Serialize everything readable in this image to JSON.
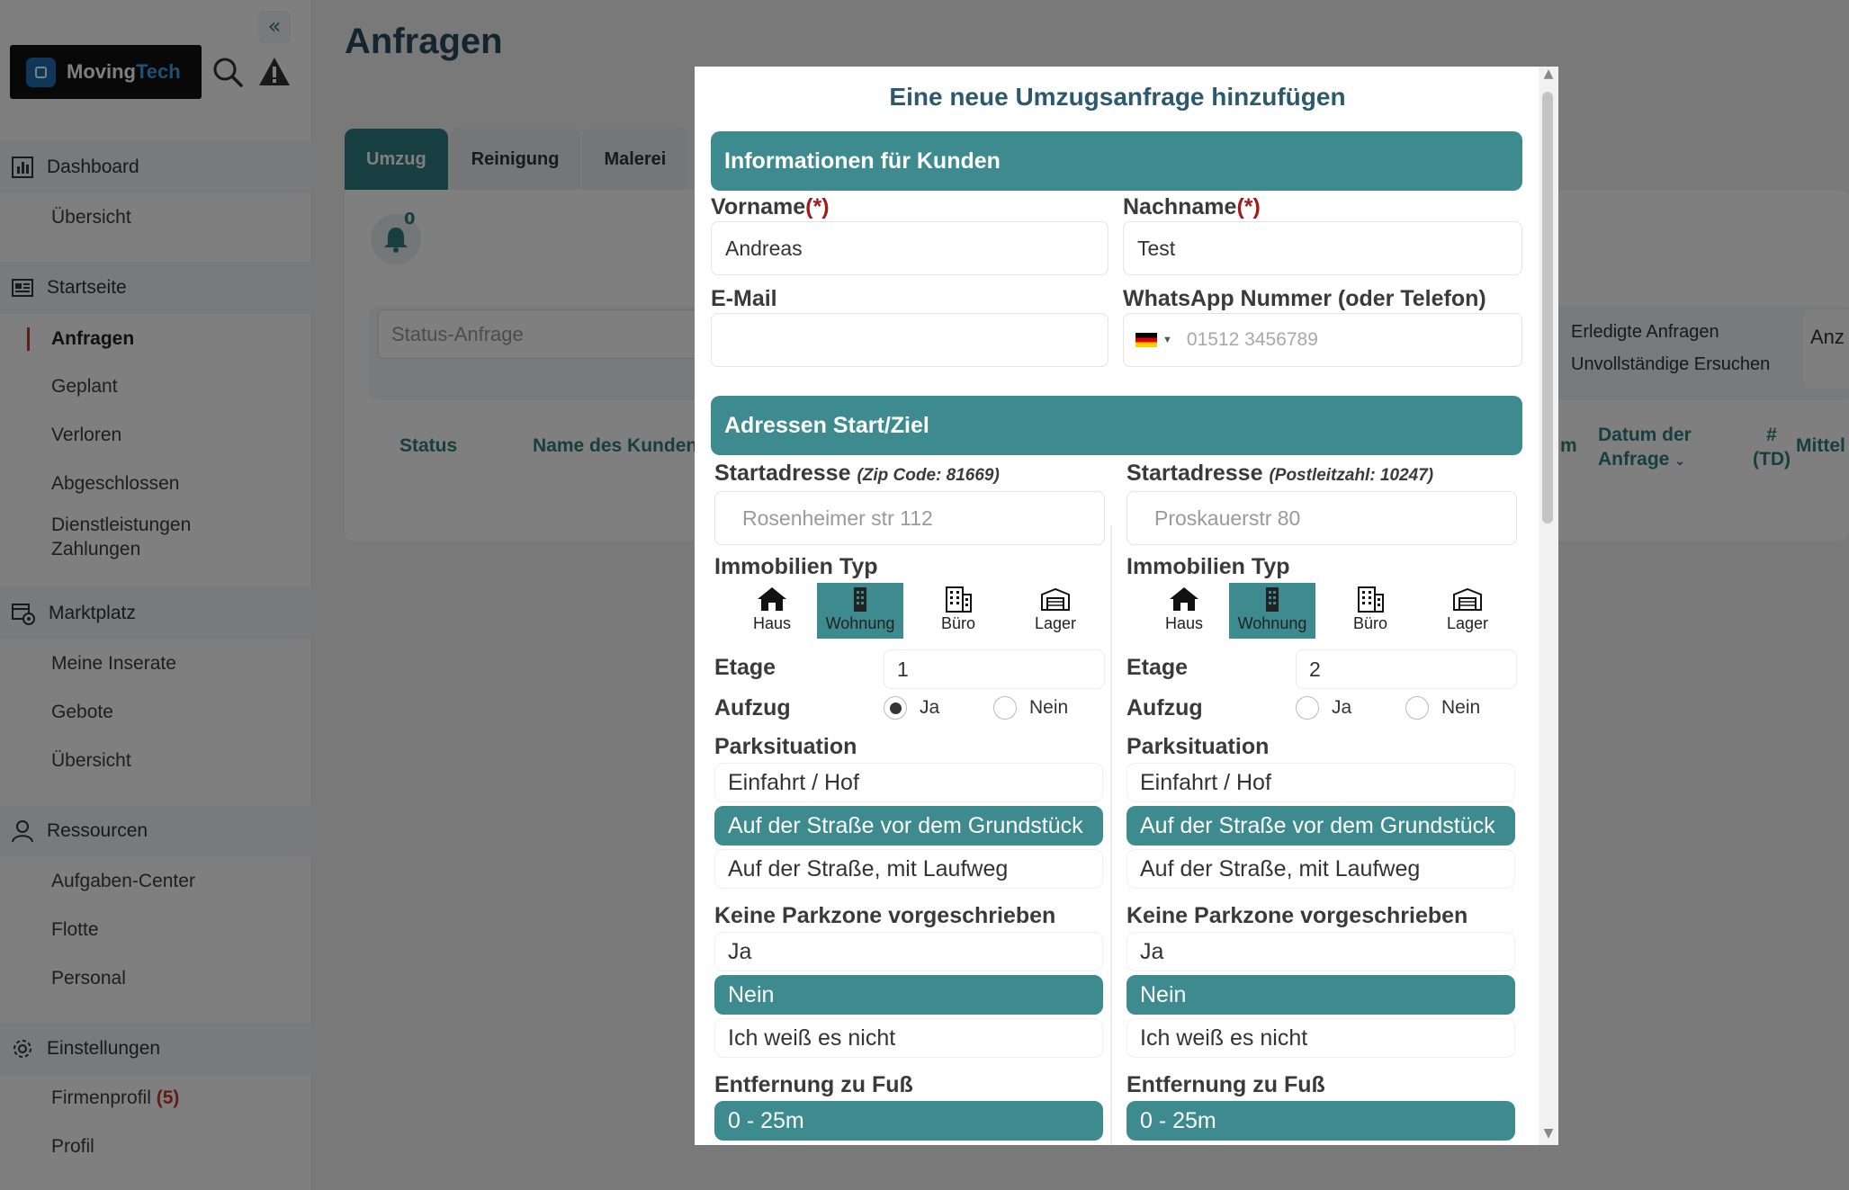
{
  "app": {
    "brand_part1": "Moving",
    "brand_part2": "Tech",
    "collapse_icon": "«"
  },
  "sidebar": {
    "dashboard": "Dashboard",
    "dashboard_items": [
      "Übersicht"
    ],
    "startseite": "Startseite",
    "startseite_items": [
      "Anfragen",
      "Geplant",
      "Verloren",
      "Abgeschlossen",
      "Dienstleistungen Zahlungen"
    ],
    "marktplatz": "Marktplatz",
    "marktplatz_items": [
      "Meine Inserate",
      "Gebote",
      "Übersicht"
    ],
    "ressourcen": "Ressourcen",
    "ressourcen_items": [
      "Aufgaben-Center",
      "Flotte",
      "Personal"
    ],
    "einstellungen": "Einstellungen",
    "firmenprofil": "Firmenprofil",
    "firmenprofil_badge": "(5)",
    "profil": "Profil"
  },
  "page": {
    "title": "Anfragen",
    "tabs": [
      "Umzug",
      "Reinigung",
      "Malerei"
    ],
    "notification_count": "0",
    "status_placeholder": "Status-Anfrage",
    "legend": [
      "Erledigte Anfragen",
      "Unvollständige Ersuchen"
    ],
    "anz_label": "Anz",
    "table_headers": {
      "status": "Status",
      "name": "Name des Kunden",
      "m": "m",
      "datum_line1": "Datum der",
      "datum_line2": "Anfrage",
      "td_line1": "#",
      "td_line2": "(TD)",
      "mittel": "Mittel"
    }
  },
  "modal": {
    "title": "Eine neue Umzugsanfrage hinzufügen",
    "section_customer": "Informationen für Kunden",
    "vorname_label": "Vorname",
    "nachname_label": "Nachname",
    "required_mark": "(*)",
    "vorname_value": "Andreas",
    "nachname_value": "Test",
    "email_label": "E-Mail",
    "email_value": "",
    "phone_label": "WhatsApp Nummer (oder Telefon)",
    "phone_placeholder": "01512 3456789",
    "section_address": "Adressen Start/Ziel",
    "type_label": "Immobilien Typ",
    "property_types": [
      "Haus",
      "Wohnung",
      "Büro",
      "Lager"
    ],
    "etage_label": "Etage",
    "aufzug_label": "Aufzug",
    "yes": "Ja",
    "no": "Nein",
    "park_label": "Parksituation",
    "park_options": [
      "Einfahrt / Hof",
      "Auf der Straße vor dem Grundstück",
      "Auf der Straße, mit Laufweg"
    ],
    "zone_label": "Keine Parkzone vorgeschrieben",
    "zone_options": [
      "Ja",
      "Nein",
      "Ich weiß es nicht"
    ],
    "distance_label": "Entfernung zu Fuß",
    "distance_value": "0 - 25m",
    "start": {
      "label": "Startadresse",
      "hint": "(Zip Code: 81669)",
      "address": "Rosenheimer str 112",
      "etage": "1",
      "aufzug": "Ja"
    },
    "dest": {
      "label": "Startadresse",
      "hint": "(Postleitzahl: 10247)",
      "address": "Proskauerstr 80",
      "etage": "2",
      "aufzug": "none"
    }
  }
}
